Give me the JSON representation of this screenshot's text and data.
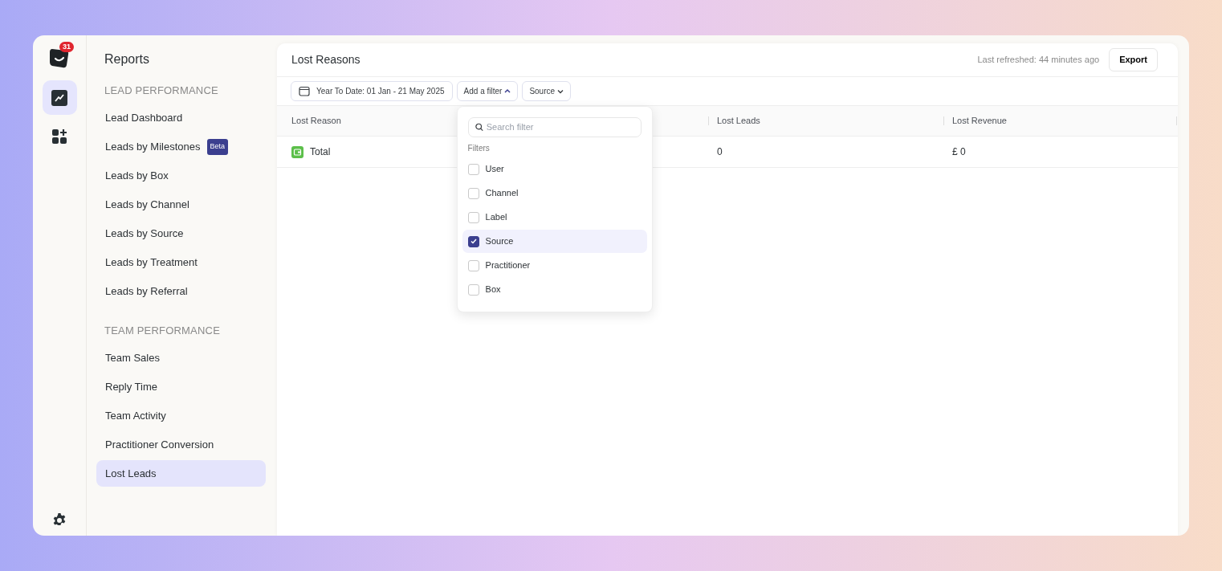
{
  "rail": {
    "notification_count": "31",
    "items": [
      {
        "kind": "chart",
        "selected": true
      },
      {
        "kind": "apps",
        "selected": false
      }
    ]
  },
  "sidebar": {
    "title": "Reports",
    "sections": [
      {
        "heading": "LEAD PERFORMANCE",
        "items": [
          {
            "label": "Lead Dashboard",
            "selected": false
          },
          {
            "label": "Leads by Milestones",
            "badge": "Beta",
            "selected": false
          },
          {
            "label": "Leads by Box",
            "selected": false
          },
          {
            "label": "Leads by Channel",
            "selected": false
          },
          {
            "label": "Leads by Source",
            "selected": false
          },
          {
            "label": "Leads by Treatment",
            "selected": false
          },
          {
            "label": "Leads by Referral",
            "selected": false
          }
        ]
      },
      {
        "heading": "TEAM PERFORMANCE",
        "items": [
          {
            "label": "Team Sales",
            "selected": false
          },
          {
            "label": "Reply Time",
            "selected": false
          },
          {
            "label": "Team Activity",
            "selected": false
          },
          {
            "label": "Practitioner Conversion",
            "selected": false
          },
          {
            "label": "Lost Leads",
            "selected": true
          }
        ]
      }
    ]
  },
  "main": {
    "title": "Lost Reasons",
    "last_refreshed": "Last refreshed: 44 minutes ago",
    "export_button": "Export",
    "filters": {
      "date": "Year To Date: 01 Jan - 21 May 2025",
      "add_filter": "Add a filter",
      "add_filter_expanded": true,
      "chips": [
        "Source"
      ]
    },
    "dropdown": {
      "search_placeholder": "Search filter",
      "heading": "Filters",
      "options": [
        {
          "label": "User",
          "checked": false
        },
        {
          "label": "Channel",
          "checked": false
        },
        {
          "label": "Label",
          "checked": false
        },
        {
          "label": "Source",
          "checked": true
        },
        {
          "label": "Practitioner",
          "checked": false
        },
        {
          "label": "Box",
          "checked": false
        }
      ]
    },
    "table": {
      "columns": [
        "Lost Reason",
        "Lost Leads",
        "Lost Revenue"
      ],
      "rows": [
        {
          "cells": [
            "Total",
            "0",
            "£ 0"
          ]
        }
      ]
    }
  }
}
